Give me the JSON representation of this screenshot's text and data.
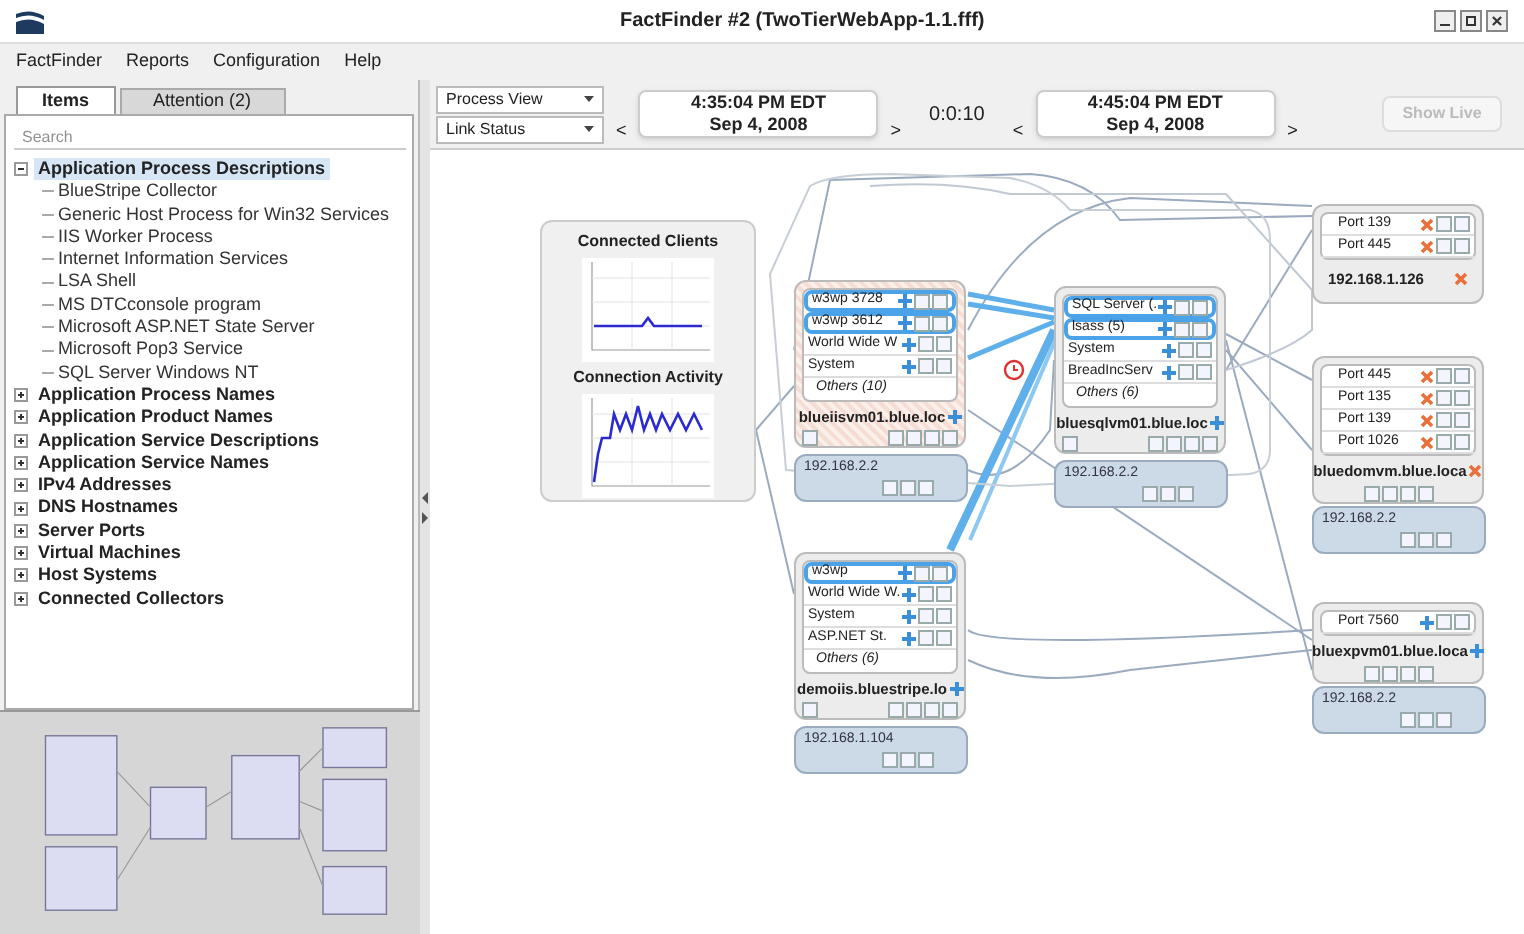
{
  "window": {
    "title": "FactFinder #2 (TwoTierWebApp-1.1.fff)"
  },
  "menu": [
    "FactFinder",
    "Reports",
    "Configuration",
    "Help"
  ],
  "tabs": [
    {
      "label": "Items",
      "selected": true
    },
    {
      "label": "Attention (2)",
      "selected": false
    }
  ],
  "search": {
    "placeholder": "Search"
  },
  "tree": [
    {
      "label": "Application Process Descriptions",
      "expanded": true,
      "selected": true,
      "children": [
        {
          "label": "BlueStripe Collector"
        },
        {
          "label": "Generic Host Process for Win32 Services"
        },
        {
          "label": "IIS Worker Process"
        },
        {
          "label": "Internet Information Services"
        },
        {
          "label": "LSA Shell"
        },
        {
          "label": "MS DTCconsole program"
        },
        {
          "label": "Microsoft ASP.NET State Server"
        },
        {
          "label": "Microsoft Pop3 Service"
        },
        {
          "label": "SQL Server Windows NT"
        }
      ]
    },
    {
      "label": "Application Process Names",
      "expanded": false,
      "selected": false
    },
    {
      "label": "Application Product Names",
      "expanded": false,
      "selected": false
    },
    {
      "label": "Application Service Descriptions",
      "expanded": false,
      "selected": false
    },
    {
      "label": "Application Service Names",
      "expanded": false,
      "selected": false
    },
    {
      "label": "IPv4 Addresses",
      "expanded": false,
      "selected": false
    },
    {
      "label": "DNS Hostnames",
      "expanded": false,
      "selected": false
    },
    {
      "label": "Server Ports",
      "expanded": false,
      "selected": false
    },
    {
      "label": "Virtual Machines",
      "expanded": false,
      "selected": false
    },
    {
      "label": "Host Systems",
      "expanded": false,
      "selected": false
    },
    {
      "label": "Connected Collectors",
      "expanded": false,
      "selected": false
    }
  ],
  "toolbar": {
    "view_select": "Process View",
    "status_select": "Link Status",
    "start": {
      "time": "4:35:04 PM EDT",
      "date": "Sep 4, 2008"
    },
    "interval": "0:0:10",
    "end": {
      "time": "4:45:04 PM EDT",
      "date": "Sep 4, 2008"
    },
    "live_button": {
      "label": "Show Live",
      "disabled": true
    },
    "prev": "<",
    "next": ">"
  },
  "charts": [
    {
      "title": "Connected Clients"
    },
    {
      "title": "Connection Activity"
    }
  ],
  "hosts": [
    {
      "hostname": "blueiisvm01.blue.loc",
      "ip": "192.168.2.2",
      "hatched": true,
      "processes": [
        {
          "name": "w3wp 3728",
          "highlighted": true
        },
        {
          "name": "w3wp 3612",
          "highlighted": true
        },
        {
          "name": "World Wide W",
          "highlighted": false
        },
        {
          "name": "System",
          "highlighted": false
        }
      ],
      "others": "Others (10)"
    },
    {
      "hostname": "bluesqlvm01.blue.loc",
      "ip": "192.168.2.2",
      "hatched": false,
      "processes": [
        {
          "name": "SQL Server (.",
          "highlighted": true
        },
        {
          "name": "lsass (5)",
          "highlighted": true
        },
        {
          "name": "System",
          "highlighted": false
        },
        {
          "name": "BreadIncServ",
          "highlighted": false
        }
      ],
      "others": "Others (6)"
    },
    {
      "hostname": "demoiis.bluestripe.lo",
      "ip": "192.168.1.104",
      "hatched": false,
      "processes": [
        {
          "name": "w3wp",
          "highlighted": true
        },
        {
          "name": "World Wide W.",
          "highlighted": false
        },
        {
          "name": "System",
          "highlighted": false
        },
        {
          "name": "ASP.NET St.",
          "highlighted": false
        }
      ],
      "others": "Others (6)"
    }
  ],
  "port_hosts": [
    {
      "hostname": "192.168.1.126",
      "alert": true,
      "ports": [
        {
          "label": "Port 139",
          "kind": "blocked"
        },
        {
          "label": "Port 445",
          "kind": "blocked"
        }
      ]
    },
    {
      "hostname": "bluedomvm.blue.loca",
      "ip": "192.168.2.2",
      "alert": true,
      "ports": [
        {
          "label": "Port 445",
          "kind": "blocked"
        },
        {
          "label": "Port 135",
          "kind": "blocked"
        },
        {
          "label": "Port 139",
          "kind": "blocked"
        },
        {
          "label": "Port 1026",
          "kind": "blocked"
        }
      ]
    },
    {
      "hostname": "bluexpvm01.blue.loca",
      "ip": "192.168.2.2",
      "alert": false,
      "ports": [
        {
          "label": "Port 7560",
          "kind": "open"
        }
      ]
    }
  ]
}
